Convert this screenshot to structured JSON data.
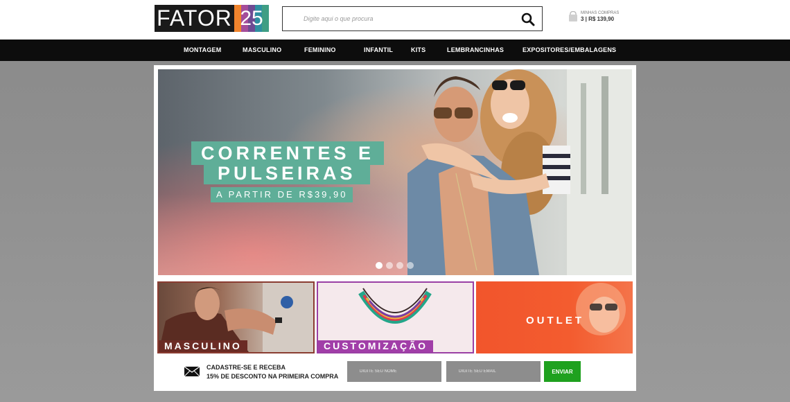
{
  "header": {
    "logo": {
      "text": "FATOR",
      "number": "25"
    },
    "top_links": [
      "",
      "",
      "",
      "",
      ""
    ],
    "search": {
      "placeholder": "Digite aqui o que procura"
    },
    "cart": {
      "label": "MINHAS COMPRAS",
      "summary": "3 | R$ 139,90"
    }
  },
  "nav": {
    "items": [
      {
        "label": "MONTAGEM"
      },
      {
        "label": "MASCULINO"
      },
      {
        "label": "FEMININO"
      },
      {
        "label": "INFANTIL"
      },
      {
        "label": "KITS"
      },
      {
        "label": "LEMBRANCINHAS"
      },
      {
        "label": "EXPOSITORES/EMBALAGENS"
      }
    ]
  },
  "hero": {
    "title_line1": "CORRENTES E",
    "title_line2": "PULSEIRAS",
    "subtitle": "A PARTIR DE R$39,90",
    "slides": 4,
    "active_slide": 1
  },
  "tiles": {
    "masculino": "MASCULINO",
    "customizacao": "CUSTOMIZAÇÃO",
    "outlet": "OUTLET"
  },
  "newsletter": {
    "line1": "CADASTRE-SE E RECEBA",
    "line2": "15% DE DESCONTO NA PRIMEIRA COMPRA",
    "name_placeholder": "DIGITE SEU NOME",
    "email_placeholder": "DIGITE SEU EMAIL",
    "submit_label": "ENVIAR"
  },
  "colors": {
    "accent_green": "#5fae98",
    "outlet_orange": "#f2552c",
    "custom_purple": "#a13ea8",
    "masc_brown": "#6b2b24",
    "send_green": "#1fa11f"
  }
}
